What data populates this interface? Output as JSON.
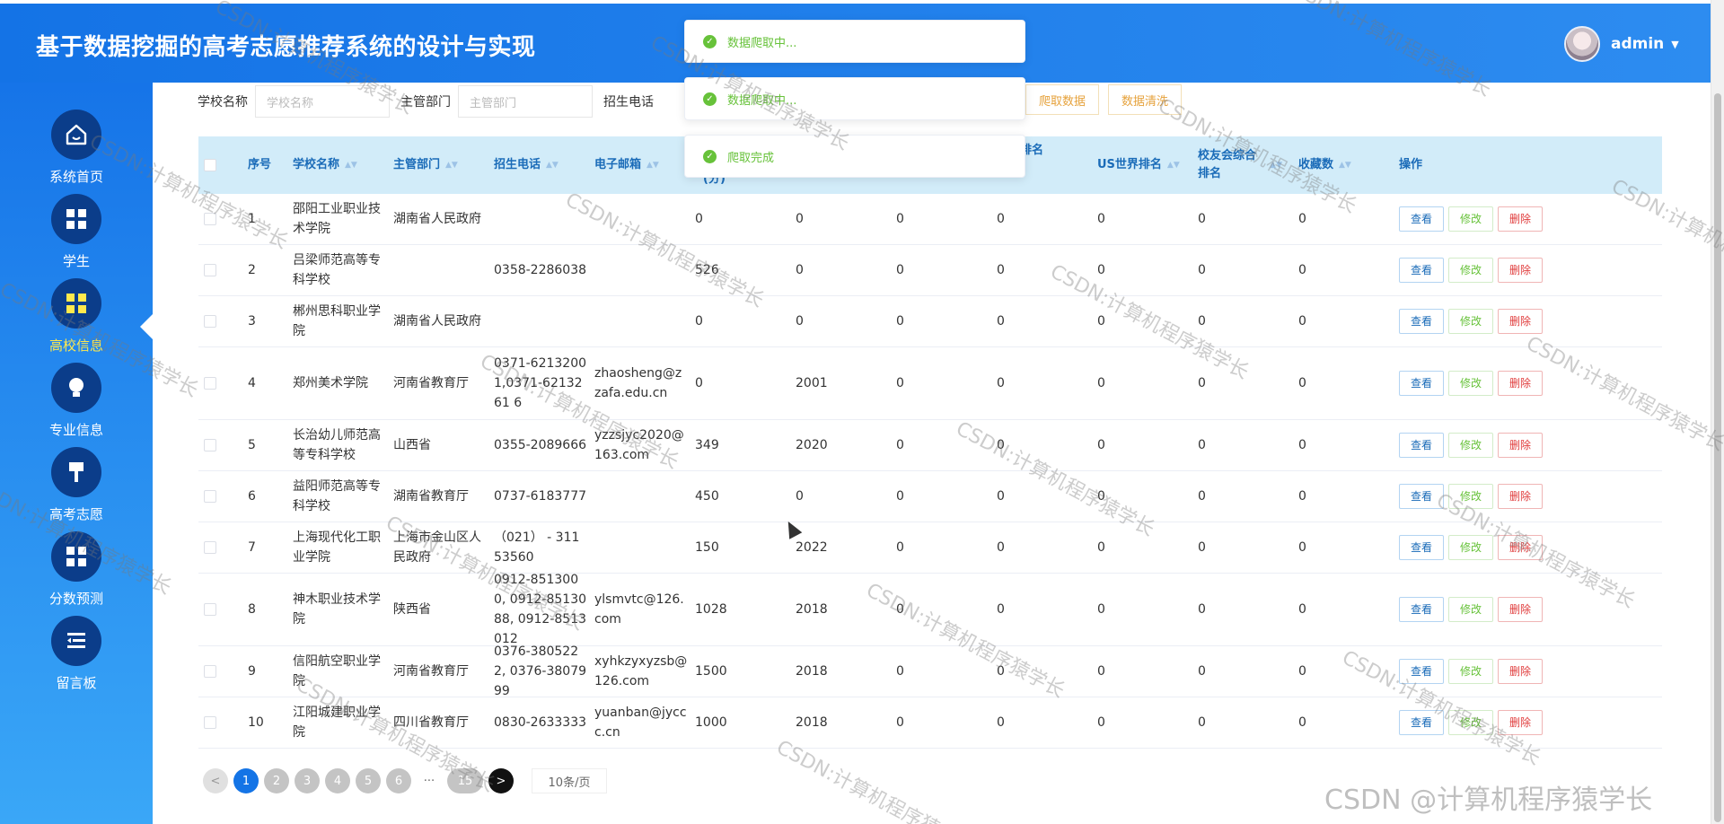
{
  "header": {
    "title": "基于数据挖掘的高考志愿推荐系统的设计与实现",
    "username": "admin"
  },
  "sidebar": {
    "items": [
      {
        "label": "系统首页",
        "icon": "home-icon"
      },
      {
        "label": "学生",
        "icon": "grid-icon"
      },
      {
        "label": "高校信息",
        "icon": "grid-icon"
      },
      {
        "label": "专业信息",
        "icon": "lightbulb-icon"
      },
      {
        "label": "高考志愿",
        "icon": "brush-icon"
      },
      {
        "label": "分数预测",
        "icon": "grid-icon"
      },
      {
        "label": "留言板",
        "icon": "list-icon"
      }
    ]
  },
  "filters": {
    "school_name_label": "学校名称",
    "school_name_placeholder": "学校名称",
    "dept_label": "主管部门",
    "dept_placeholder": "主管部门",
    "phone_label": "招生电话",
    "crawl_button": "爬取数据",
    "clean_button": "数据清洗"
  },
  "toasts": [
    "数据爬取中...",
    "数据爬取中...",
    "爬取完成"
  ],
  "table": {
    "headers": {
      "index": "序号",
      "name": "学校名称",
      "dept": "主管部门",
      "phone": "招生电话",
      "email": "电子邮箱",
      "col6": "(分)",
      "col9": "综合排名",
      "us": "US世界排名",
      "alumni": "校友会综合排名",
      "fav": "收藏数",
      "ops": "操作"
    },
    "rows": [
      {
        "idx": "1",
        "name": "邵阳工业职业技术学院",
        "dept": "湖南省人民政府",
        "phone": "",
        "email": "",
        "c6": "0",
        "c7": "0",
        "c8": "0",
        "c9": "0",
        "c10": "0",
        "c11": "0",
        "c12": "0"
      },
      {
        "idx": "2",
        "name": "吕梁师范高等专科学校",
        "dept": "",
        "phone": "0358-2286038",
        "email": "",
        "c6": "526",
        "c7": "0",
        "c8": "0",
        "c9": "0",
        "c10": "0",
        "c11": "0",
        "c12": "0"
      },
      {
        "idx": "3",
        "name": "郴州思科职业学院",
        "dept": "湖南省人民政府",
        "phone": "",
        "email": "",
        "c6": "0",
        "c7": "0",
        "c8": "0",
        "c9": "0",
        "c10": "0",
        "c11": "0",
        "c12": "0"
      },
      {
        "idx": "4",
        "name": "郑州美术学院",
        "dept": "河南省教育厅",
        "phone": "0371-62132001,0371-6213261 6",
        "email": "zhaosheng@zzafa.edu.cn",
        "c6": "0",
        "c7": "2001",
        "c8": "0",
        "c9": "0",
        "c10": "0",
        "c11": "0",
        "c12": "0"
      },
      {
        "idx": "5",
        "name": "长治幼儿师范高等专科学校",
        "dept": "山西省",
        "phone": "0355-2089666",
        "email": "yzzsjyc2020@163.com",
        "c6": "349",
        "c7": "2020",
        "c8": "0",
        "c9": "0",
        "c10": "0",
        "c11": "0",
        "c12": "0"
      },
      {
        "idx": "6",
        "name": "益阳师范高等专科学校",
        "dept": "湖南省教育厅",
        "phone": "0737-6183777",
        "email": "",
        "c6": "450",
        "c7": "0",
        "c8": "0",
        "c9": "0",
        "c10": "0",
        "c11": "0",
        "c12": "0"
      },
      {
        "idx": "7",
        "name": "上海现代化工职业学院",
        "dept": "上海市金山区人民政府",
        "phone": "（021） - 31153560",
        "email": "",
        "c6": "150",
        "c7": "2022",
        "c8": "0",
        "c9": "0",
        "c10": "0",
        "c11": "0",
        "c12": "0"
      },
      {
        "idx": "8",
        "name": "神木职业技术学院",
        "dept": "陕西省",
        "phone": "0912-8513000, 0912-8513088, 0912-8513012",
        "email": "ylsmvtc@126.com",
        "c6": "1028",
        "c7": "2018",
        "c8": "0",
        "c9": "0",
        "c10": "0",
        "c11": "0",
        "c12": "0"
      },
      {
        "idx": "9",
        "name": "信阳航空职业学院",
        "dept": "河南省教育厅",
        "phone": "0376-3805222, 0376-3807999",
        "email": "xyhkzyxyzsb@126.com",
        "c6": "1500",
        "c7": "2018",
        "c8": "0",
        "c9": "0",
        "c10": "0",
        "c11": "0",
        "c12": "0"
      },
      {
        "idx": "10",
        "name": "江阳城建职业学院",
        "dept": "四川省教育厅",
        "phone": "0830-2633333",
        "email": "yuanban@jyccc.cn",
        "c6": "1000",
        "c7": "2018",
        "c8": "0",
        "c9": "0",
        "c10": "0",
        "c11": "0",
        "c12": "0"
      }
    ],
    "actions": {
      "view": "查看",
      "edit": "修改",
      "delete": "删除"
    }
  },
  "pagination": {
    "prev": "<",
    "pages": [
      "1",
      "2",
      "3",
      "4",
      "5",
      "6"
    ],
    "ellipsis": "···",
    "last": "15",
    "next": ">",
    "page_size": "10条/页"
  },
  "watermark": {
    "text": "CSDN:计算机程序猿学长",
    "footer": "CSDN @计算机程序猿学长"
  },
  "colors": {
    "header": "#1473e6",
    "accent": "#1474e6",
    "sidebar_active": "#ffe94d",
    "success": "#67c23a",
    "danger": "#e03c3c",
    "warning": "#e6a23c"
  }
}
